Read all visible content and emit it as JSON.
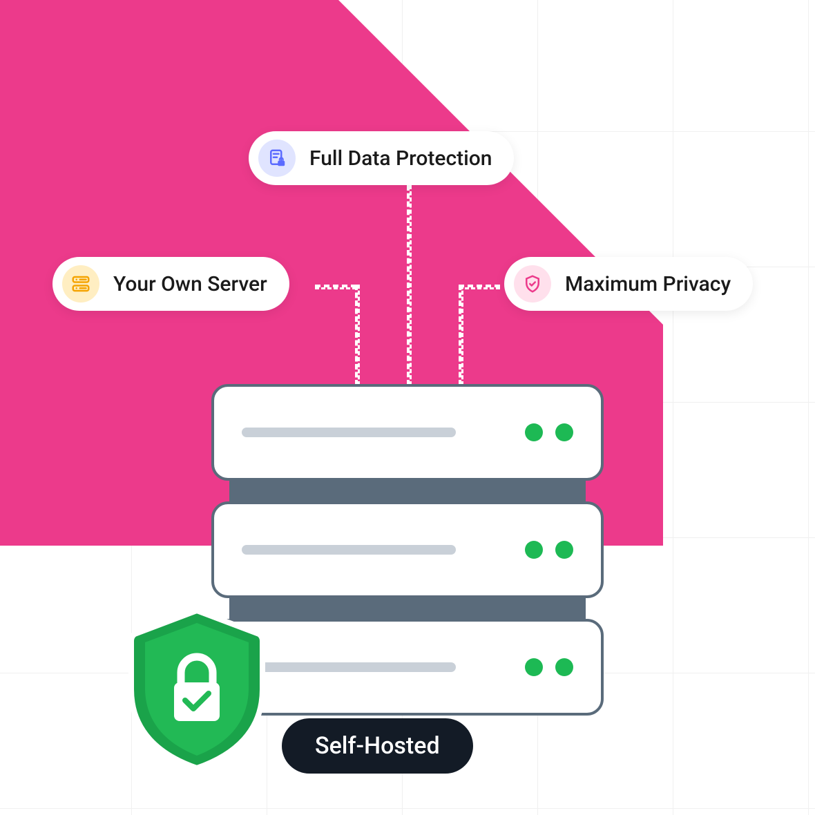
{
  "pills": {
    "top": {
      "label": "Full Data Protection",
      "icon": "document-lock-icon"
    },
    "left": {
      "label": "Your Own Server",
      "icon": "server-icon"
    },
    "right": {
      "label": "Maximum Privacy",
      "icon": "shield-check-icon"
    }
  },
  "label": "Self-Hosted",
  "colors": {
    "accent_pink": "#ec3a8b",
    "status_green": "#1db954",
    "chip_dark": "#131b26"
  }
}
